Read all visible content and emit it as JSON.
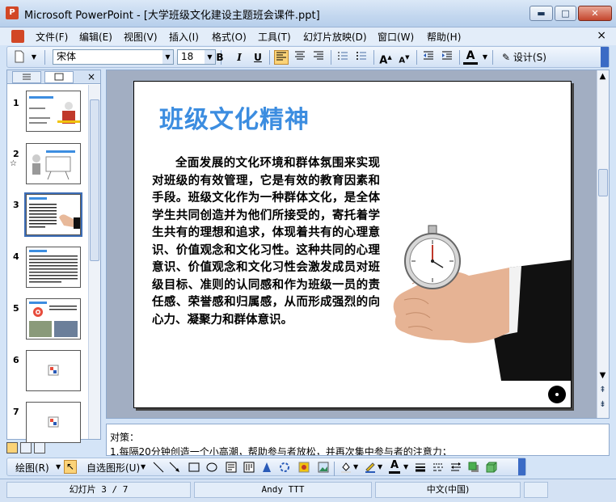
{
  "window": {
    "title": "Microsoft PowerPoint - [大学班级文化建设主题班会课件.ppt]",
    "app_icon_letter": "P",
    "min_symbol": "▬",
    "max_symbol": "□",
    "close_symbol": "✕"
  },
  "menu": {
    "items": [
      "文件(F)",
      "编辑(E)",
      "视图(V)",
      "插入(I)",
      "格式(O)",
      "工具(T)",
      "幻灯片放映(D)",
      "窗口(W)",
      "帮助(H)"
    ],
    "close_symbol": "×"
  },
  "toolbar": {
    "font_name": "宋体",
    "font_size": "18",
    "bold": "B",
    "italic": "I",
    "underline": "U",
    "design_label": "设计(S)"
  },
  "left_pane": {
    "close_symbol": "×",
    "slide_numbers": [
      "1",
      "2",
      "3",
      "4",
      "5",
      "6",
      "7"
    ],
    "selected_index": 3
  },
  "slide": {
    "title": "班级文化精神",
    "body": "全面发展的文化环境和群体氛围来实现对班级的有效管理，它是有效的教育因素和手段。班级文化作为一种群体文化，是全体学生共同创造并为他们所接受的，寄托着学生共有的理想和追求，体现着共有的心理意识、价值观念和文化习性。这种共同的心理意识、价值观念和文化习性会激发成员对班级目标、准则的认同感和作为班级一员的责任感、荣誉感和归属感，从而形成强烈的向心力、凝聚力和群体意识。"
  },
  "notes": {
    "line1": "对策：",
    "line2": "1.每隔20分钟创造一个小高潮，帮助参与者放松，并再次集中参与者的注意力；"
  },
  "drawbar": {
    "draw_label": "绘图(R)",
    "autoshape_label": "自选图形(U)"
  },
  "status": {
    "slide_info": "幻灯片 3 / 7",
    "template": "Andy TTT",
    "language": "中文(中国)"
  },
  "colors": {
    "title_blue": "#3c8de0",
    "accent": "#d24726"
  }
}
